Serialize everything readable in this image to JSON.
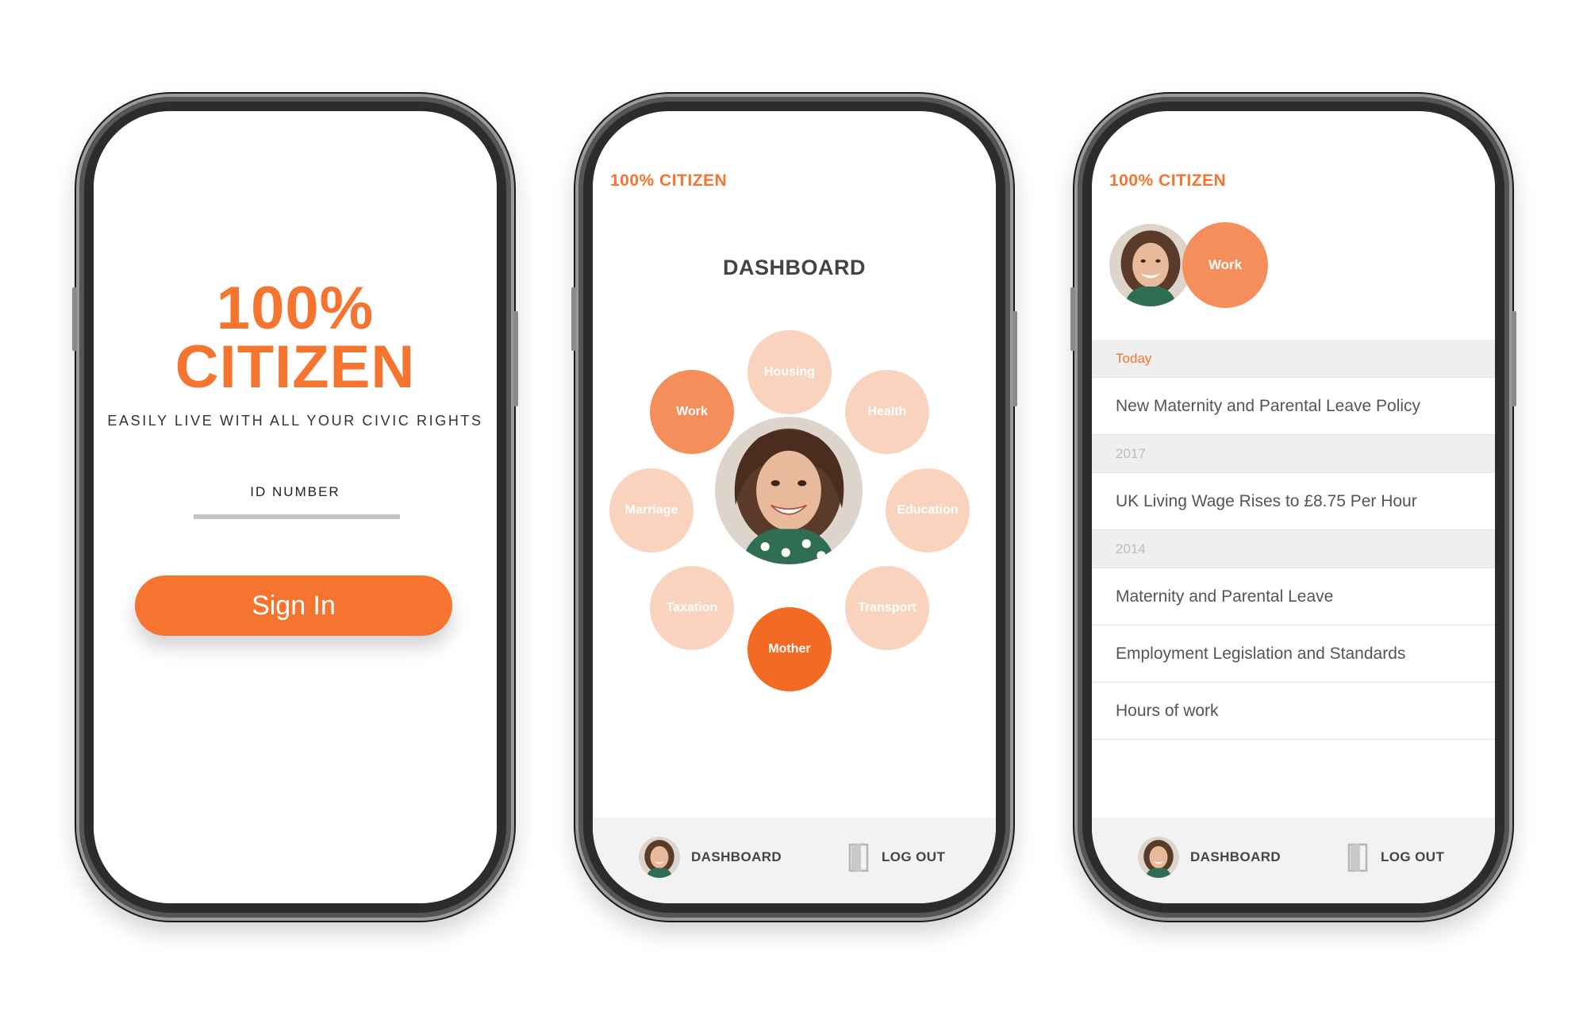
{
  "signin": {
    "logo_line1": "100%",
    "logo_line2": "CITIZEN",
    "tagline": "EASILY LIVE WITH ALL YOUR CIVIC RIGHTS",
    "id_label": "ID NUMBER",
    "id_value": "",
    "button_label": "Sign In"
  },
  "dashboard": {
    "app_title": "100% CITIZEN",
    "title": "DASHBOARD",
    "categories": [
      "Housing",
      "Health",
      "Education",
      "Transport",
      "Mother",
      "Taxation",
      "Marriage",
      "Work"
    ],
    "active_category": "Mother"
  },
  "work": {
    "app_title": "100% CITIZEN",
    "category": "Work",
    "sections": [
      {
        "header": "Today",
        "items": [
          "New Maternity and Parental Leave Policy"
        ]
      },
      {
        "header": "2017",
        "items": [
          "UK Living Wage Rises to £8.75 Per Hour"
        ]
      },
      {
        "header": "2014",
        "items": [
          "Maternity and Parental Leave",
          "Employment Legislation and Standards",
          "Hours of work"
        ]
      }
    ]
  },
  "nav": {
    "dashboard_label": "DASHBOARD",
    "logout_label": "LOG OUT"
  },
  "colors": {
    "accent": "#f47430",
    "bubble_light": "#fad3bf",
    "bubble_mid": "#f48f5b",
    "bubble_dark": "#f26a23",
    "bar_bg": "#f2f2f2"
  },
  "icons": [
    "user-avatar",
    "door-icon"
  ]
}
